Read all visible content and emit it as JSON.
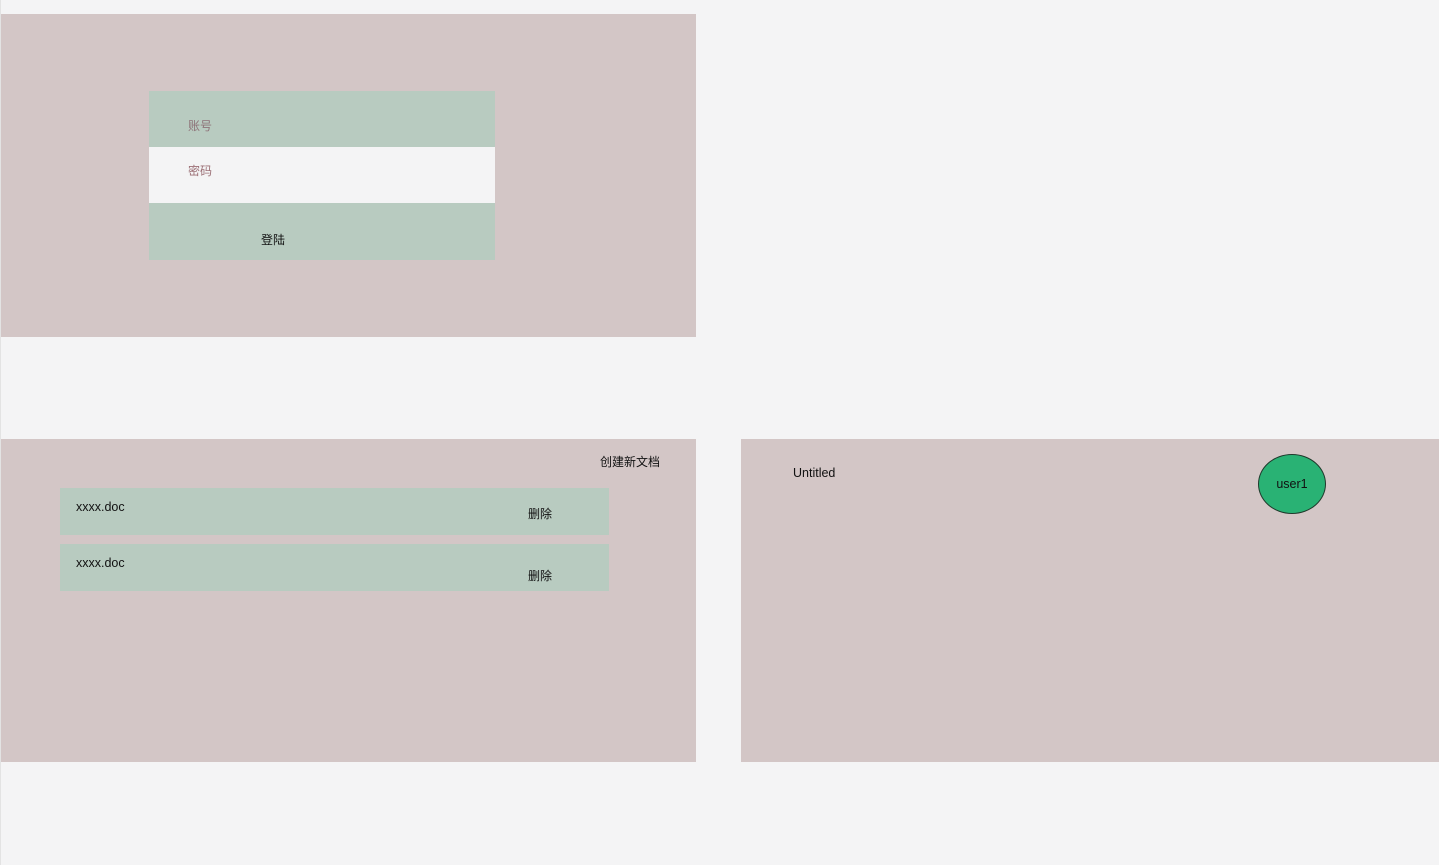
{
  "login": {
    "account_placeholder": "账号",
    "password_placeholder": "密码",
    "submit_label": "登陆"
  },
  "documents": {
    "create_label": "创建新文档",
    "items": [
      {
        "name": "xxxx.doc",
        "delete_label": "删除"
      },
      {
        "name": "xxxx.doc",
        "delete_label": "删除"
      }
    ]
  },
  "editor": {
    "title": "Untitled",
    "user": "user1"
  },
  "colors": {
    "page_background": "#f4f4f5",
    "frame_background": "#d3c6c6",
    "accent_green": "#b8cbc0",
    "avatar_green": "#29b274",
    "placeholder_text": "#9b6f75"
  }
}
